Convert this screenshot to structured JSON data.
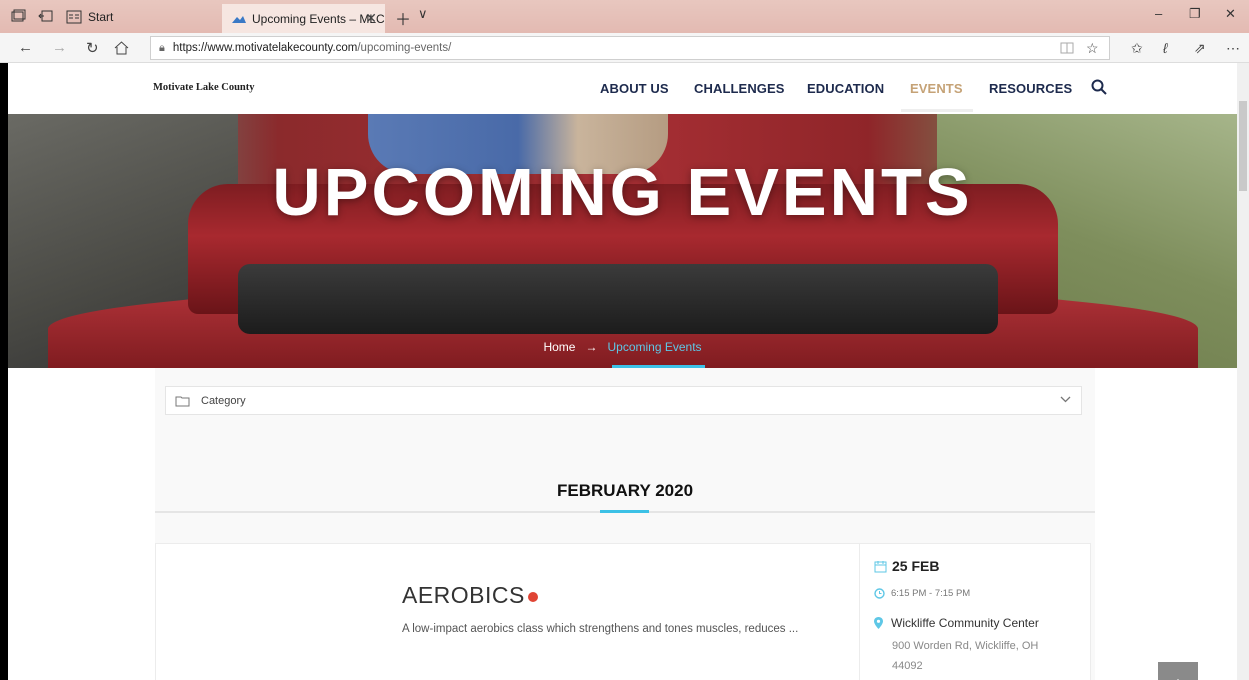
{
  "browser": {
    "start_tab_label": "Start",
    "active_tab_title": "Upcoming Events – MLC",
    "url_host": "https://www.motivatelakecounty.com",
    "url_path": "/upcoming-events/"
  },
  "site": {
    "logo_text": "Motivate Lake County",
    "nav": [
      {
        "label": "ABOUT US"
      },
      {
        "label": "CHALLENGES"
      },
      {
        "label": "EDUCATION"
      },
      {
        "label": "EVENTS"
      },
      {
        "label": "RESOURCES"
      }
    ]
  },
  "hero": {
    "title": "UPCOMING EVENTS",
    "breadcrumb_home": "Home",
    "breadcrumb_arrow": "→",
    "breadcrumb_current": "Upcoming Events"
  },
  "filters": {
    "category_placeholder": "Category"
  },
  "month_heading": "FEBRUARY 2020",
  "event": {
    "title": "AEROBICS",
    "description": "A low-impact aerobics class which strengthens and tones muscles, reduces ...",
    "date": "25 FEB",
    "time": "6:15 PM - 7:15 PM",
    "venue": "Wickliffe Community Center",
    "address": "900 Worden Rd, Wickliffe, OH 44092"
  },
  "colors": {
    "nav_text": "#1d2a4d",
    "nav_active": "#c5a276",
    "accent": "#3cc1e6",
    "event_dot": "#e04434"
  }
}
